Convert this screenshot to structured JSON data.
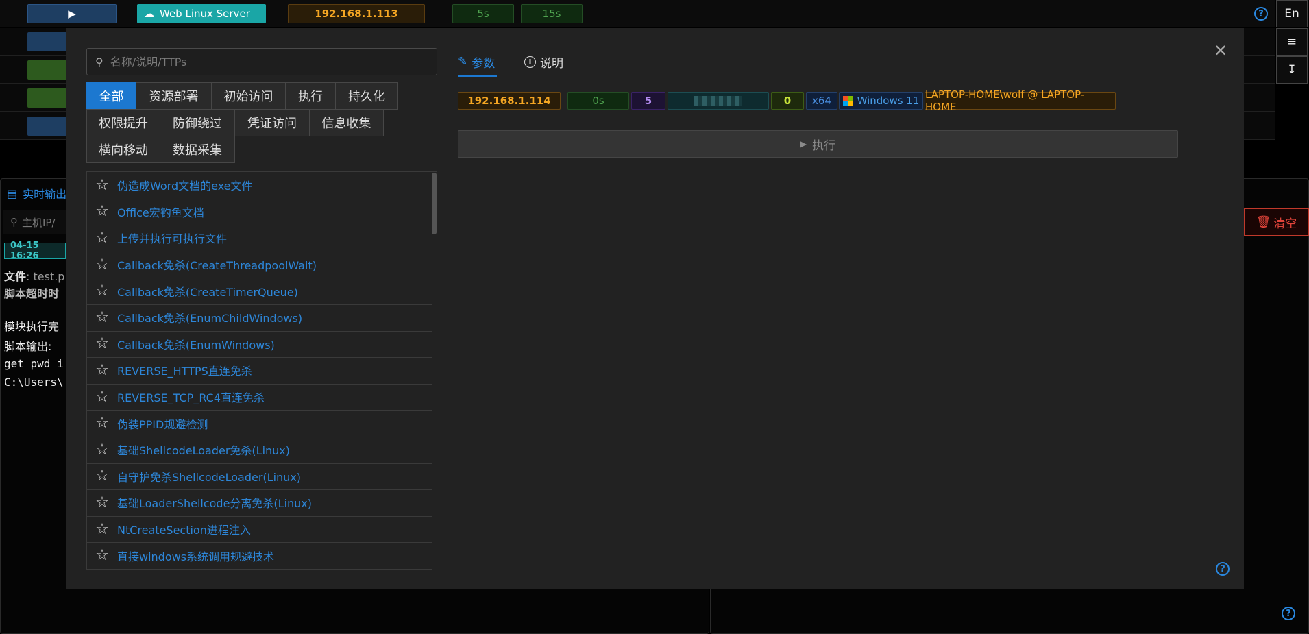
{
  "topbar": {
    "server_name": "Web Linux Server",
    "ip": "192.168.1.113",
    "timer1": "5s",
    "timer2": "15s",
    "lang": "En"
  },
  "background_panel": {
    "tab_label": "实时输出",
    "search_placeholder": "主机IP/",
    "clear_label": "清空",
    "log_time": "04-15 16:26",
    "log_file_label": "文件",
    "log_file_value": ": test.p",
    "log_timeout": "脚本超时时",
    "log_done": "模块执行完",
    "log_output": "脚本输出:",
    "log_cmd": "get pwd i",
    "log_path": "C:\\Users\\"
  },
  "modal": {
    "search_placeholder": "名称/说明/TTPs",
    "categories": [
      "全部",
      "资源部署",
      "初始访问",
      "执行",
      "持久化",
      "权限提升",
      "防御绕过",
      "凭证访问",
      "信息收集",
      "横向移动",
      "数据采集"
    ],
    "modules": [
      "伪造成Word文档的exe文件",
      "Office宏钓鱼文档",
      "上传并执行可执行文件",
      "Callback免杀(CreateThreadpoolWait)",
      "Callback免杀(CreateTimerQueue)",
      "Callback免杀(EnumChildWindows)",
      "Callback免杀(EnumWindows)",
      "REVERSE_HTTPS直连免杀",
      "REVERSE_TCP_RC4直连免杀",
      "伪装PPID规避检测",
      "基础ShellcodeLoader免杀(Linux)",
      "自守护免杀ShellcodeLoader(Linux)",
      "基础LoaderShellcode分离免杀(Linux)",
      "NtCreateSection进程注入",
      "直接windows系统调用规避技术"
    ],
    "tabs": {
      "params": "参数",
      "description": "说明"
    },
    "session": {
      "ip": "192.168.1.114",
      "time": "0s",
      "pid": "5",
      "count": "0",
      "arch": "x64",
      "os": "Windows 11",
      "user": "LAPTOP-HOME\\wolf @ LAPTOP-HOME"
    },
    "execute_label": "执行",
    "help_icon_text": "?"
  },
  "colors": {
    "accent": "#1c78d0",
    "link": "#2d86d8",
    "teal": "#1aa6a6",
    "orange": "#f5a623"
  }
}
